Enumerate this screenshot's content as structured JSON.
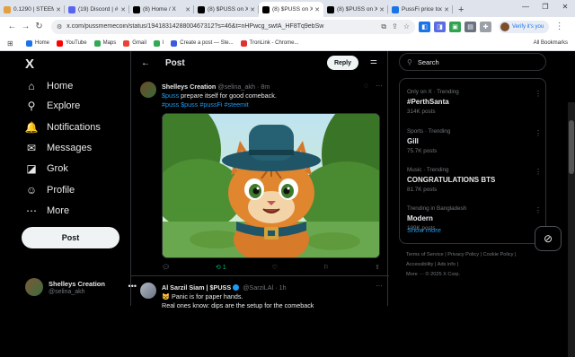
{
  "browser": {
    "tabs": [
      {
        "title": "0.1290 | STEEM",
        "color": "#e2a03f",
        "active": false
      },
      {
        "title": "(19) Discord | #",
        "color": "#5865f2",
        "active": false
      },
      {
        "title": "(8) Home / X",
        "color": "#000000",
        "active": false
      },
      {
        "title": "(8) $PUSS on X",
        "color": "#000000",
        "active": false
      },
      {
        "title": "(8) $PUSS on X",
        "color": "#000000",
        "active": true
      },
      {
        "title": "(8) $PUSS on X",
        "color": "#000000",
        "active": false
      },
      {
        "title": "PussFi price too",
        "color": "#1a73e8",
        "active": false
      }
    ],
    "new_tab": "+",
    "url": "x.com/pussmemecoin/status/1941831428800467312?s=46&t=nHPwcg_swfA_HF8Tq9ebSw",
    "verify_label": "Verify it's you",
    "bookmarks": [
      {
        "label": "Home",
        "color": "#1a73e8"
      },
      {
        "label": "YouTube",
        "color": "#ff0000"
      },
      {
        "label": "Maps",
        "color": "#34a853"
      },
      {
        "label": "Gmail",
        "color": "#ea4335"
      },
      {
        "label": "l",
        "color": "#34a853"
      },
      {
        "label": "Create a post — Ste...",
        "color": "#3b5bdb"
      },
      {
        "label": "TronLink - Chrome...",
        "color": "#e03131"
      }
    ],
    "all_bookmarks": "All Bookmarks"
  },
  "sidebar": {
    "logo": "X",
    "items": [
      {
        "label": "Home",
        "icon": "home-icon",
        "glyph": "⌂"
      },
      {
        "label": "Explore",
        "icon": "search-icon",
        "glyph": "⚲"
      },
      {
        "label": "Notifications",
        "icon": "bell-icon",
        "glyph": "🔔"
      },
      {
        "label": "Messages",
        "icon": "envelope-icon",
        "glyph": "✉"
      },
      {
        "label": "Grok",
        "icon": "grok-icon",
        "glyph": "◪"
      },
      {
        "label": "Profile",
        "icon": "person-icon",
        "glyph": "☺"
      },
      {
        "label": "More",
        "icon": "more-circle-icon",
        "glyph": "⋯"
      }
    ],
    "post_button": "Post",
    "account": {
      "name": "Shelleys Creation",
      "handle": "@selina_akh",
      "menu": "•••"
    }
  },
  "main": {
    "title": "Post",
    "reply_button": "Reply",
    "tweet": {
      "name": "Shelleys Creation",
      "handle": "@selina_akh",
      "time": "· 8m",
      "text_cashtag": "$puss",
      "text_body": " prepare itself for good comeback.",
      "hashtags": "#puss $puss #pussFi #steemit",
      "retweets": "1"
    },
    "tweet2": {
      "name": "Al Sarzil Siam | $PUSS",
      "handle": "@SarziLAl",
      "time": "· 1h",
      "line1": "😺 Panic is for paper hands.",
      "line2": "Real ones know: dips are the setup for the comeback"
    }
  },
  "right": {
    "search_placeholder": "Search",
    "trends": [
      {
        "context": "Only on X · Trending",
        "title": "#PerthSanta",
        "posts": "314K posts"
      },
      {
        "context": "Sports · Trending",
        "title": "Gill",
        "posts": "75.7K posts"
      },
      {
        "context": "Music · Trending",
        "title": "CONGRATULATIONS BTS",
        "posts": "81.7K posts"
      },
      {
        "context": "Trending in Bangladesh",
        "title": "Modern",
        "posts": "109K posts"
      }
    ],
    "show_more": "Show more",
    "footer_line1": "Terms of Service  |  Privacy Policy  |  Cookie Policy  |",
    "footer_line2": "Accessibility  |  Ads info  |",
    "footer_line3": "More ···   © 2025 X Corp."
  }
}
